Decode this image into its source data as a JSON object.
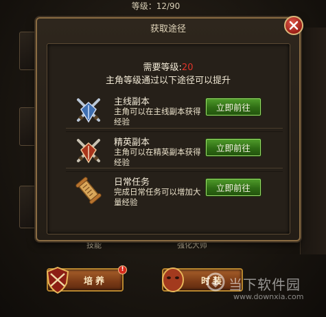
{
  "background": {
    "level_text": "等级：12/90",
    "skill_label": "技能",
    "master_label": "强化大师",
    "cultivate_button": "培养",
    "cultivate_alert": "!",
    "second_button": "时装"
  },
  "dialog": {
    "title": "获取途径",
    "required_level_label": "需要等级:",
    "required_level_value": "20",
    "hint": "主角等级通过以下途径可以提升",
    "routes": [
      {
        "name": "主线副本",
        "desc": "主角可以在主线副本获得经验",
        "button": "立即前往",
        "icon": "crossed-swords-blue-icon"
      },
      {
        "name": "精英副本",
        "desc": "主角可以在精英副本获得经验",
        "button": "立即前往",
        "icon": "crossed-swords-red-icon"
      },
      {
        "name": "日常任务",
        "desc": "完成日常任务可以增加大量经验",
        "button": "立即前往",
        "icon": "scroll-icon"
      }
    ]
  },
  "watermark": {
    "name": "当下软件园",
    "url": "www.downxia.com"
  },
  "colors": {
    "accent_red": "#e0342a",
    "go_button_green": "#2e6c14",
    "frame_gold": "#8a6c43"
  }
}
